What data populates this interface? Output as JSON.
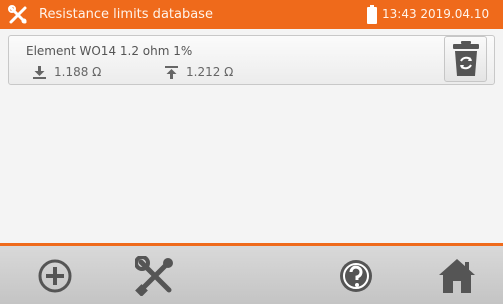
{
  "header": {
    "title": "Resistance limits database",
    "clock": "13:43 2019.04.10",
    "app_icon": "tools-icon",
    "battery_icon": "battery-icon"
  },
  "entries": [
    {
      "name": "Element WO14 1.2 ohm 1%",
      "lower_limit": "1.188 Ω",
      "upper_limit": "1.212 Ω",
      "lower_icon": "lower-limit-icon",
      "upper_icon": "upper-limit-icon"
    }
  ],
  "actions": {
    "delete_icon": "recycle-bin-icon"
  },
  "toolbar": {
    "add_icon": "add-icon",
    "settings_icon": "tools-icon",
    "help_icon": "help-icon",
    "home_icon": "home-icon"
  },
  "colors": {
    "accent": "#ef6a1b",
    "icon_gray": "#555555"
  }
}
